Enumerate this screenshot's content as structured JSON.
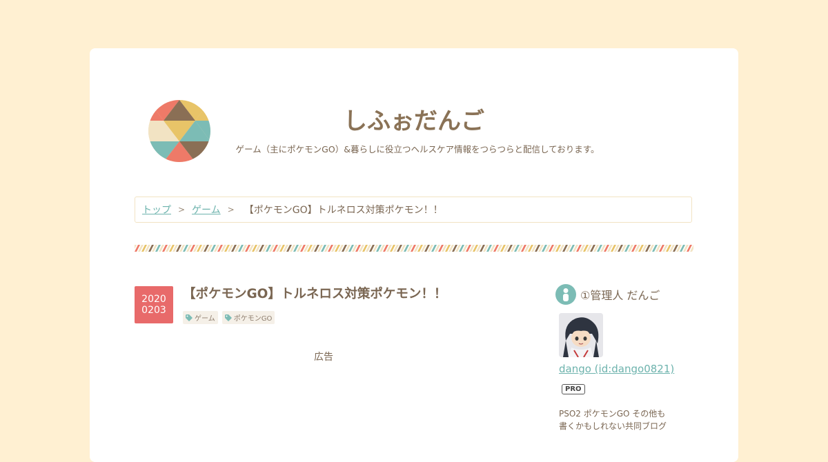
{
  "site": {
    "title": "しふぉだんご",
    "description": "ゲーム（主にポケモンGO）&暮らしに役立つヘルスケア情報をつらつらと配信しております。"
  },
  "breadcrumb": {
    "items": [
      "トップ",
      "ゲーム"
    ],
    "separator": ">",
    "current": "【ポケモンGO】トルネロス対策ポケモン！！"
  },
  "entry": {
    "date_year": "2020",
    "date_monthday": "0203",
    "title": "【ポケモンGO】トルネロス対策ポケモン！！",
    "tags": [
      "ゲーム",
      "ポケモンGO"
    ],
    "ad_label": "広告"
  },
  "sidebar": {
    "heading": "①管理人 だんご",
    "profile_name": "dango (id:dango0821)",
    "badge": "PRO",
    "description_lines": [
      "PSO2 ポケモンGO その他も",
      "書くかもしれない共同ブログ"
    ]
  },
  "colors": {
    "background": "#fff0d2",
    "accent_teal": "#7cbcb5",
    "accent_coral": "#ee7a68",
    "accent_yellow": "#e8c468",
    "accent_brown": "#8a6f55",
    "date_badge": "#e86a6a",
    "link": "#6db3ad"
  },
  "icons": {
    "logo": "triangle-pattern-circle-logo",
    "tag": "tag-icon",
    "sidebar_heading": "user-icon"
  }
}
